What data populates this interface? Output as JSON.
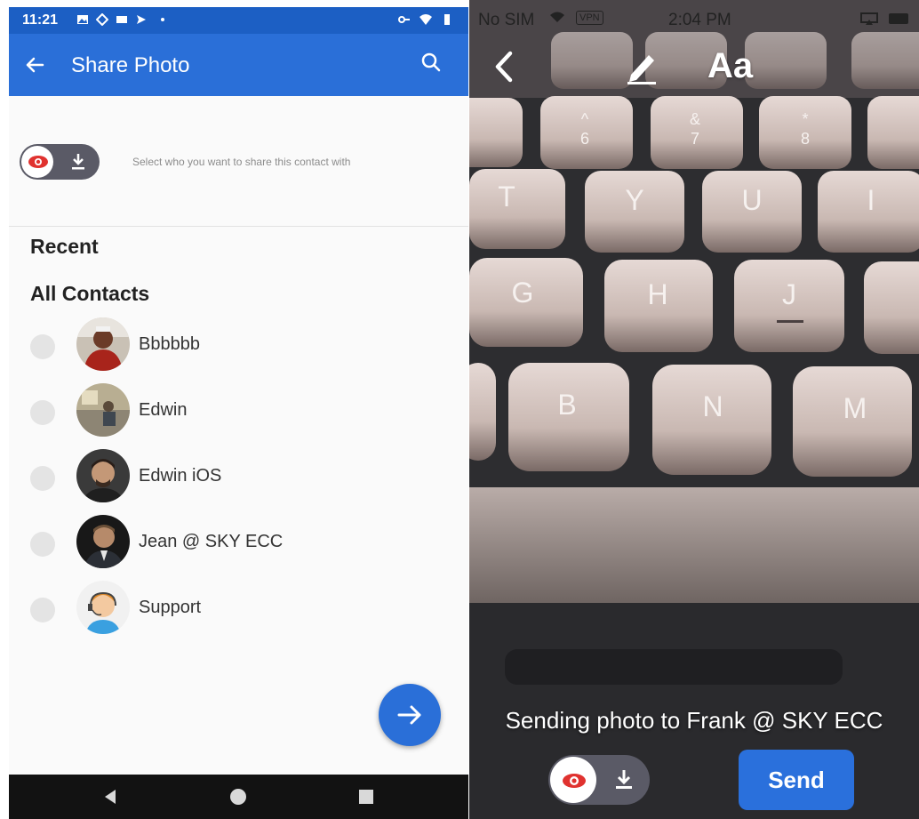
{
  "android": {
    "status": {
      "time": "11:21"
    },
    "appbar": {
      "title": "Share Photo"
    },
    "share_hint": "Select who you want to share this contact with",
    "sections": {
      "recent": "Recent",
      "all_contacts": "All Contacts"
    },
    "contacts": [
      {
        "name": "Bbbbbb"
      },
      {
        "name": "Edwin"
      },
      {
        "name": "Edwin iOS"
      },
      {
        "name": "Jean @ SKY ECC"
      },
      {
        "name": "Support"
      }
    ],
    "colors": {
      "appbar": "#2a6fd8",
      "status_bar": "#1c5fc4",
      "fab": "#2a6fd8",
      "eye_icon": "#e0322f"
    }
  },
  "ios": {
    "status": {
      "carrier": "No SIM",
      "vpn": "VPN",
      "time": "2:04 PM"
    },
    "text_tool": "Aa",
    "sending_text": "Sending photo to Frank @ SKY ECC",
    "send_label": "Send",
    "colors": {
      "send_button": "#2a70dc"
    }
  }
}
